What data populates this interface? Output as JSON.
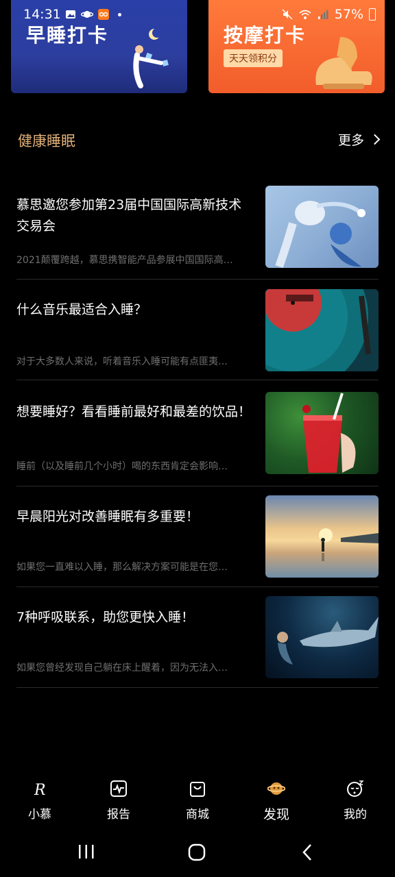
{
  "status_bar": {
    "time": "14:31",
    "battery": "57%"
  },
  "banners": [
    {
      "title": "早睡打卡",
      "subtitle": ""
    },
    {
      "title": "按摩打卡",
      "subtitle": "天天领积分"
    }
  ],
  "section": {
    "title": "健康睡眠",
    "more": "更多"
  },
  "articles": [
    {
      "title": "慕思邀您参加第23届中国国际高新技术交易会",
      "desc": "2021颠覆跨越，慕思携智能产品参展中国国际高…",
      "image": "robot-figure"
    },
    {
      "title": "什么音乐最适合入睡？",
      "desc": "对于大多数人来说，听着音乐入睡可能有点匪夷…",
      "image": "vinyl-record"
    },
    {
      "title": "想要睡好？看看睡前最好和最差的饮品！",
      "desc": "睡前（以及睡前几个小时）喝的东西肯定会影响…",
      "image": "red-drink"
    },
    {
      "title": "早晨阳光对改善睡眠有多重要！",
      "desc": "如果您一直难以入睡，那么解决方案可能是在您…",
      "image": "sunset-beach"
    },
    {
      "title": "7种呼吸联系，助您更快入睡！",
      "desc": "如果您曾经发现自己躺在床上醒着，因为无法入…",
      "image": "diver-shark"
    }
  ],
  "bottom_nav": [
    {
      "label": "小慕",
      "icon": "logo-r-icon"
    },
    {
      "label": "报告",
      "icon": "report-icon"
    },
    {
      "label": "商城",
      "icon": "shopping-bag-icon"
    },
    {
      "label": "发现",
      "icon": "planet-icon",
      "active": true
    },
    {
      "label": "我的",
      "icon": "sleepy-face-icon"
    }
  ],
  "colors": {
    "accent": "#e0b07a",
    "banner_sleep": "#2c3e9e",
    "banner_massage": "#f25d2b"
  }
}
